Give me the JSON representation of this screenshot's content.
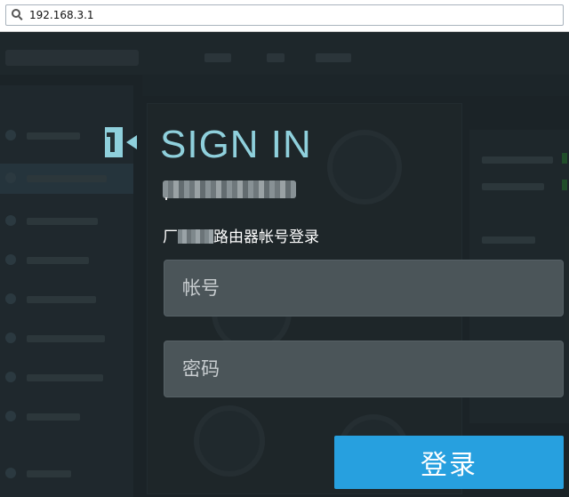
{
  "browser": {
    "url": "192.168.3.1"
  },
  "signin": {
    "title": "SIGN IN",
    "description_prefix": "厂",
    "description_suffix": "路由器帐号登录",
    "account_placeholder": "帐号",
    "password_placeholder": "密码",
    "login_label": "登录"
  },
  "icons": {
    "address": "search-icon",
    "signin": "sign-in-door-icon"
  },
  "colors": {
    "accent": "#8fd0dc",
    "button": "#27a0df",
    "field": "#4b5559"
  }
}
